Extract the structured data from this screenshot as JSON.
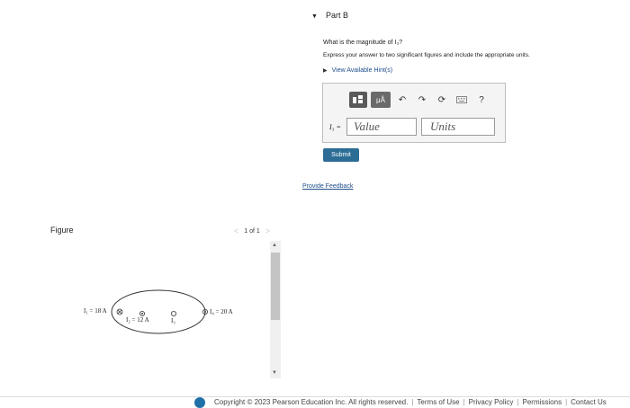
{
  "part": {
    "title": "Part B"
  },
  "question": {
    "text": "What is the magnitude of I₃?",
    "instruction": "Express your answer to two significant figures and include the appropriate units.",
    "hints_link": "View Available Hint(s)"
  },
  "toolbar": {
    "template_icon": "fraction-template-icon",
    "units_label": "μÅ",
    "undo_icon": "undo-icon",
    "redo_icon": "redo-icon",
    "reset_icon": "reset-icon",
    "keyboard_icon": "keyboard-icon",
    "help_label": "?"
  },
  "answer": {
    "variable_label": "I₃ =",
    "value_placeholder": "Value",
    "units_placeholder": "Units"
  },
  "submit_label": "Submit",
  "feedback_link": "Provide Feedback",
  "figure": {
    "title": "Figure",
    "pager": "1 of 1",
    "prev": "<",
    "next": ">",
    "labels": {
      "i1": "I₁ = 18 A",
      "i2": "I₂ = 12 A",
      "i3": "I₃",
      "i4": "I₄ = 20 A"
    }
  },
  "footer": {
    "copyright": "Copyright © 2023 Pearson Education Inc. All rights reserved.",
    "links": [
      "Terms of Use",
      "Privacy Policy",
      "Permissions",
      "Contact Us"
    ]
  },
  "colors": {
    "submit": "#2c6d96",
    "link": "#1f4e8c",
    "logo": "#1f6fa8"
  }
}
